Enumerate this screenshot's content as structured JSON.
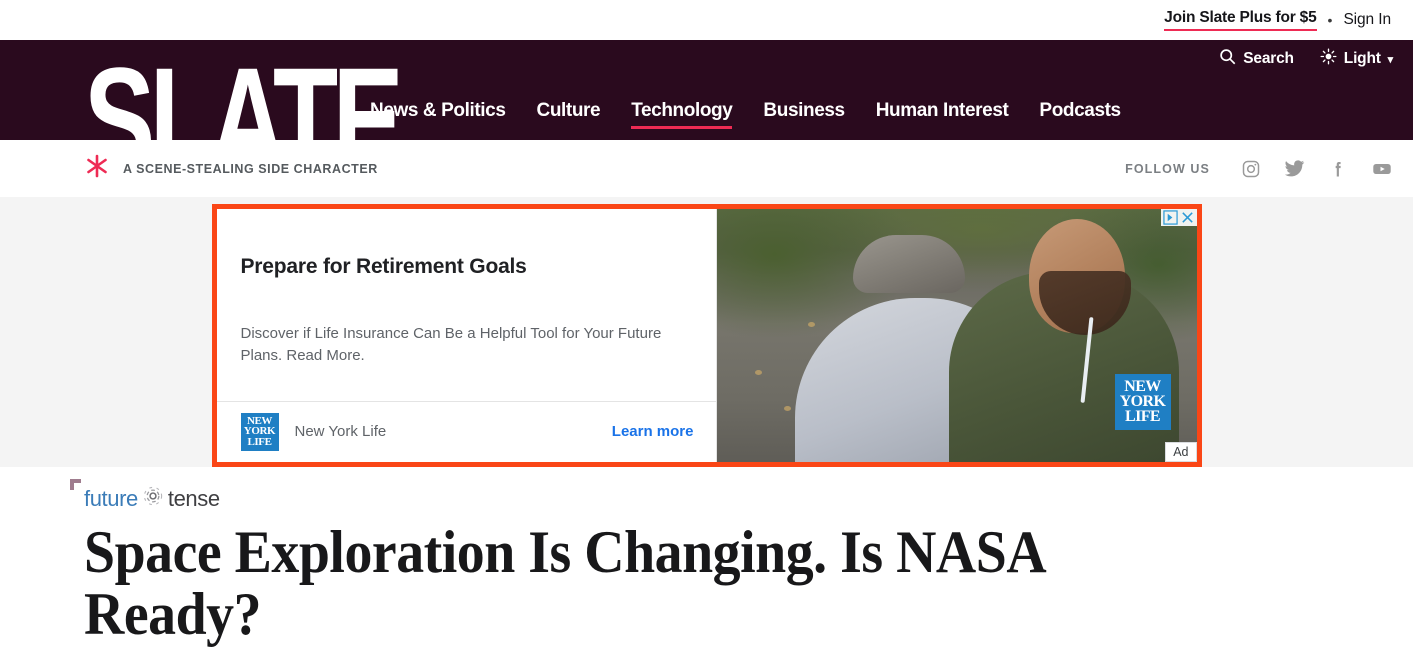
{
  "topbar": {
    "join_label": "Join Slate Plus for $5",
    "separator": "•",
    "signin_label": "Sign In"
  },
  "nav": {
    "logo_text": "SLATE",
    "search_label": "Search",
    "theme_label": "Light",
    "theme_caret": "▾",
    "items": [
      {
        "label": "News & Politics",
        "active": false
      },
      {
        "label": "Culture",
        "active": false
      },
      {
        "label": "Technology",
        "active": true
      },
      {
        "label": "Business",
        "active": false
      },
      {
        "label": "Human Interest",
        "active": false
      },
      {
        "label": "Podcasts",
        "active": false
      }
    ],
    "accent_color": "#ee2b54",
    "band_color": "#2a0a1e"
  },
  "subbar": {
    "tagline": "A SCENE-STEALING SIDE CHARACTER",
    "follow_label": "FOLLOW US",
    "socials": [
      "instagram",
      "twitter",
      "facebook",
      "youtube"
    ]
  },
  "ad": {
    "highlight_color": "#fa4616",
    "headline": "Prepare for Retirement Goals",
    "description": "Discover if Life Insurance Can Be a Helpful Tool for Your Future Plans. Read More.",
    "advertiser": "New York Life",
    "cta_label": "Learn more",
    "logo_lines": [
      "NEW",
      "YORK",
      "LIFE"
    ],
    "badge_label": "Ad",
    "adchoices_label": "AdChoices",
    "close_label": "Close ad"
  },
  "article": {
    "section_logo": {
      "first": "future",
      "second": "tense"
    },
    "headline": "Space Exploration Is Changing. Is NASA Ready?"
  }
}
